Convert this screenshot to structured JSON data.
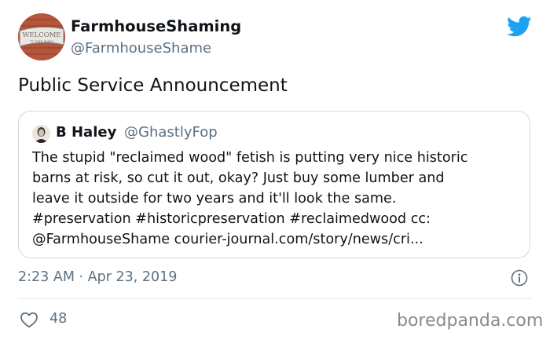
{
  "author": {
    "display_name": "FarmhouseShaming",
    "handle": "@FarmhouseShame",
    "avatar_sign_text": "WELCOME",
    "avatar_sign_subtext": "TO THE FARM"
  },
  "tweet": {
    "text": "Public Service Announcement",
    "timestamp": "2:23 AM · Apr 23, 2019",
    "likes": "48"
  },
  "quote": {
    "display_name": "B Haley",
    "handle": "@GhastlyFop",
    "lines": [
      "The stupid \"reclaimed wood\" fetish is putting very nice historic",
      "barns at risk, so cut it out, okay? Just buy some lumber and",
      "leave it outside for two years and it'll look the same.",
      "#preservation #historicpreservation #reclaimedwood cc:",
      "@FarmhouseShame courier-journal.com/story/news/cri..."
    ]
  },
  "watermark": "boredpanda.com",
  "colors": {
    "twitter_blue": "#1da1f2",
    "secondary_text": "#5b7083",
    "border": "#cfd9de"
  },
  "icons": [
    "twitter-bird-icon",
    "info-icon",
    "heart-icon"
  ]
}
